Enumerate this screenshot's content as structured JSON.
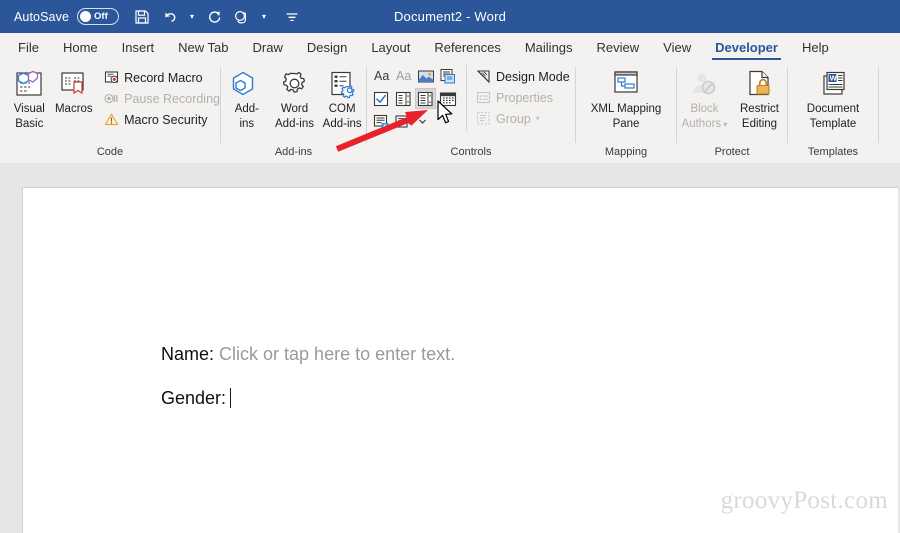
{
  "titlebar": {
    "autosave_label": "AutoSave",
    "autosave_state": "Off",
    "save_icon": "save-icon",
    "undo_icon": "undo-icon",
    "redo_icon": "redo-icon",
    "touch_icon": "touch-mode-icon",
    "customize_icon": "customize-quick-access-toolbar-icon",
    "document_title": "Document2  -  Word",
    "accent_color": "#2b579a"
  },
  "tabs": [
    {
      "label": "File",
      "active": false
    },
    {
      "label": "Home",
      "active": false
    },
    {
      "label": "Insert",
      "active": false
    },
    {
      "label": "New Tab",
      "active": false
    },
    {
      "label": "Draw",
      "active": false
    },
    {
      "label": "Design",
      "active": false
    },
    {
      "label": "Layout",
      "active": false
    },
    {
      "label": "References",
      "active": false
    },
    {
      "label": "Mailings",
      "active": false
    },
    {
      "label": "Review",
      "active": false
    },
    {
      "label": "View",
      "active": false
    },
    {
      "label": "Developer",
      "active": true
    },
    {
      "label": "Help",
      "active": false
    }
  ],
  "ribbon": {
    "groups": {
      "code": {
        "label": "Code",
        "visual_basic": "Visual Basic",
        "visual_basic_line1": "Visual",
        "visual_basic_line2": "Basic",
        "macros": "Macros",
        "record_macro": "Record Macro",
        "pause_recording": "Pause Recording",
        "macro_security": "Macro Security"
      },
      "addins": {
        "label": "Add-ins",
        "addins_line1": "Add-",
        "addins_line2": "ins",
        "word_addins_line1": "Word",
        "word_addins_line2": "Add-ins",
        "com_addins_line1": "COM",
        "com_addins_line2": "Add-ins"
      },
      "controls": {
        "label": "Controls",
        "design_mode": "Design Mode",
        "properties": "Properties",
        "group": "Group",
        "buttons": [
          {
            "name": "rich-text-content-control",
            "hovered": false
          },
          {
            "name": "plain-text-content-control",
            "hovered": false
          },
          {
            "name": "picture-content-control",
            "hovered": false
          },
          {
            "name": "building-block-gallery-content-control",
            "hovered": false
          },
          {
            "name": "check-box-content-control",
            "hovered": false
          },
          {
            "name": "combo-box-content-control",
            "hovered": false
          },
          {
            "name": "drop-down-list-content-control",
            "hovered": true
          },
          {
            "name": "date-picker-content-control",
            "hovered": false
          },
          {
            "name": "repeating-section-content-control",
            "hovered": false
          },
          {
            "name": "legacy-tools",
            "hovered": false
          }
        ]
      },
      "mapping": {
        "label": "Mapping",
        "xml_mapping_pane_line1": "XML Mapping",
        "xml_mapping_pane_line2": "Pane"
      },
      "protect": {
        "label": "Protect",
        "block_authors_line1": "Block",
        "block_authors_line2": "Authors",
        "restrict_editing_line1": "Restrict",
        "restrict_editing_line2": "Editing"
      },
      "templates": {
        "label": "Templates",
        "document_template_line1": "Document",
        "document_template_line2": "Template"
      }
    }
  },
  "document": {
    "line1_label": "Name:",
    "line1_placeholder": "Click or tap here to enter text.",
    "line2_label": "Gender:",
    "watermark": "groovyPost.com"
  },
  "annotation": {
    "arrow_color": "#e8222a",
    "points_to": "drop-down-list-content-control"
  }
}
